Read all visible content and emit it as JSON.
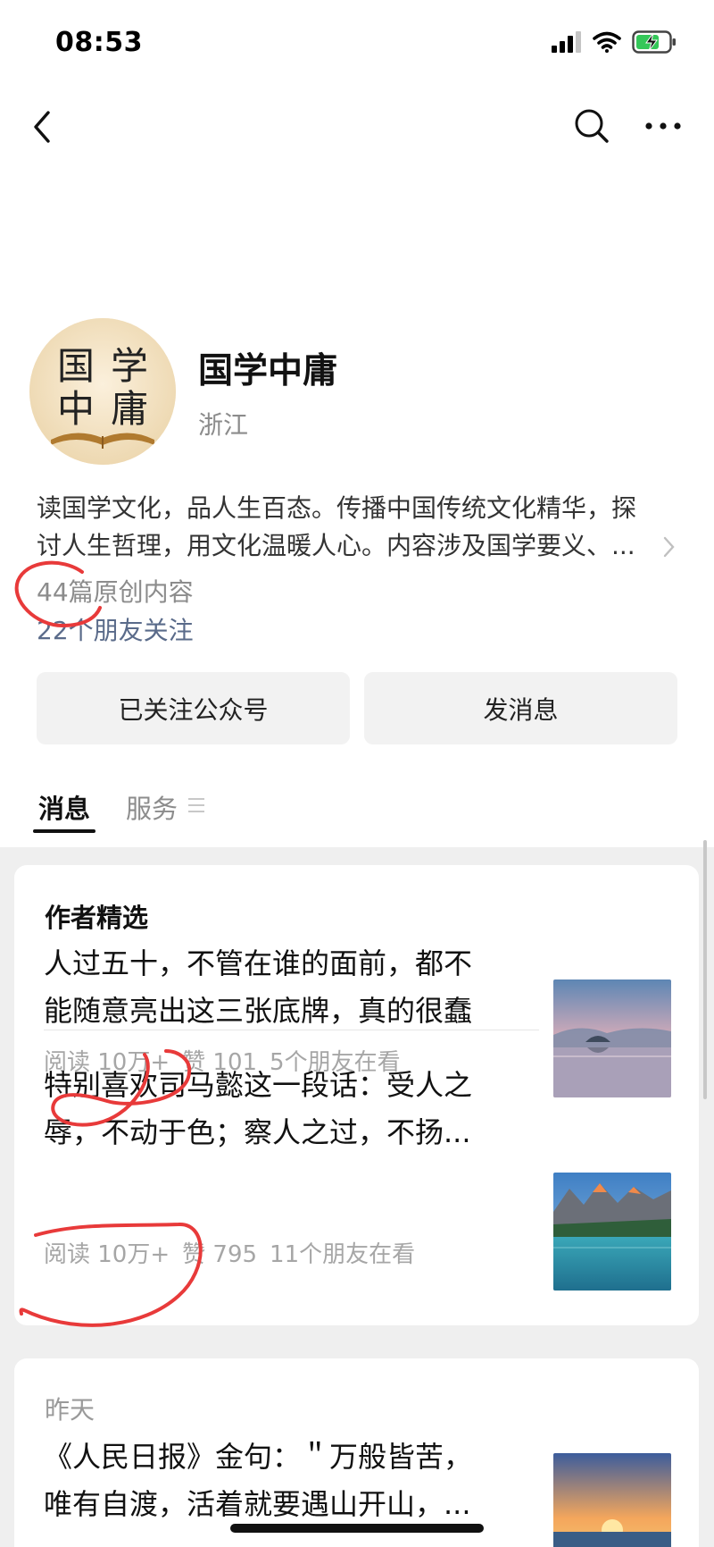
{
  "status_bar": {
    "time": "08:53"
  },
  "account": {
    "name": "国学中庸",
    "region": "浙江",
    "avatar_text": [
      "国",
      "学",
      "中",
      "庸"
    ],
    "description_lines": [
      "读国学文化，品人生百态。传播中国传统文化精华，探",
      "讨人生哲理，用文化温暖人心。内容涉及国学要义、..."
    ],
    "original_count": "44篇原创内容",
    "friends_following": "22个朋友关注"
  },
  "buttons": {
    "follow": "已关注公众号",
    "message": "发消息"
  },
  "tabs": {
    "messages": "消息",
    "services": "服务"
  },
  "featured": {
    "title": "作者精选",
    "articles": [
      {
        "title_lines": [
          "人过五十，不管在谁的面前，都不",
          "能随意亮出这三张底牌，真的很蠢"
        ],
        "reads": "阅读 10万+",
        "likes": "赞 101",
        "friends": "5个朋友在看",
        "thumb": "misty-lake-island"
      },
      {
        "title_lines": [
          "特别喜欢司马懿这一段话：受人之",
          "辱，不动于色；察人之过，不扬..."
        ],
        "reads": "阅读 10万+",
        "likes": "赞 795",
        "friends": "11个朋友在看",
        "thumb": "mountain-lake-reflection"
      }
    ]
  },
  "yesterday": {
    "date": "昨天",
    "articles": [
      {
        "title_lines": [
          "《人民日报》金句：＂万般皆苦，",
          "唯有自渡，活着就要遇山开山，..."
        ],
        "thumb": "sea-sunset"
      }
    ]
  },
  "colors": {
    "link": "#5a6b8a",
    "muted": "#8c8c8c",
    "annotation": "#e83a3a",
    "battery": "#34c759"
  }
}
